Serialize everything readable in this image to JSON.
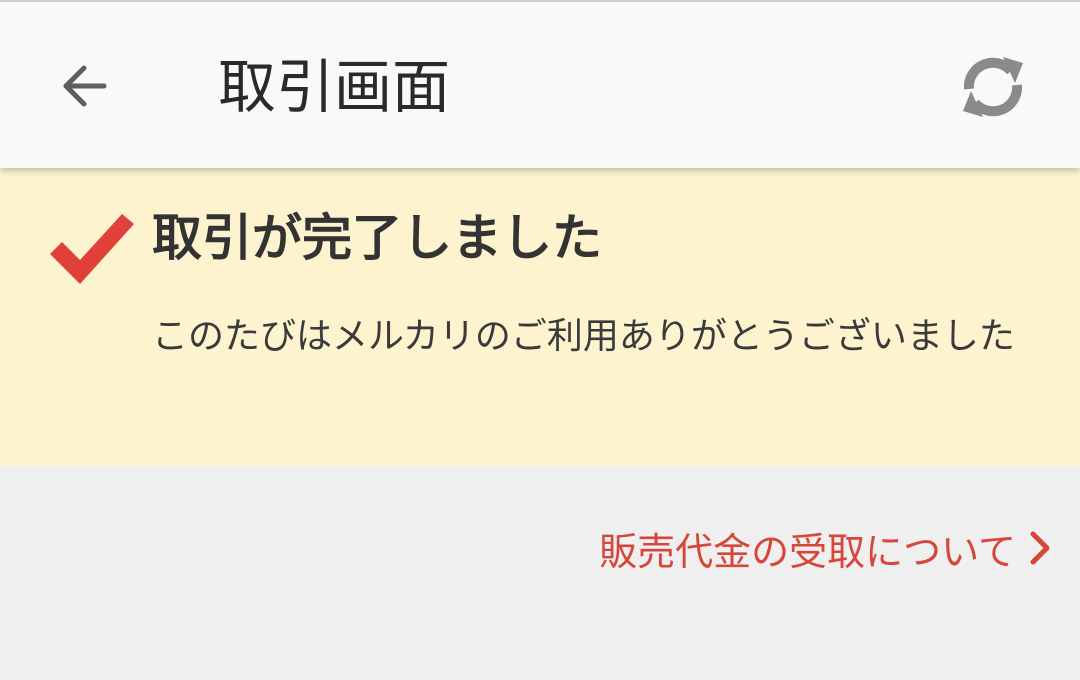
{
  "app_bar": {
    "title": "取引画面",
    "back_icon": "arrow-left-icon",
    "refresh_icon": "refresh-icon"
  },
  "banner": {
    "icon": "check-icon",
    "title": "取引が完了しました",
    "message": "このたびはメルカリのご利用ありがとうございました"
  },
  "payout_link": {
    "label": "販売代金の受取について",
    "icon": "chevron-right-icon"
  },
  "colors": {
    "accent_red": "#e0413a",
    "banner_background": "#fdf4cf",
    "link_red": "#d6463a"
  }
}
